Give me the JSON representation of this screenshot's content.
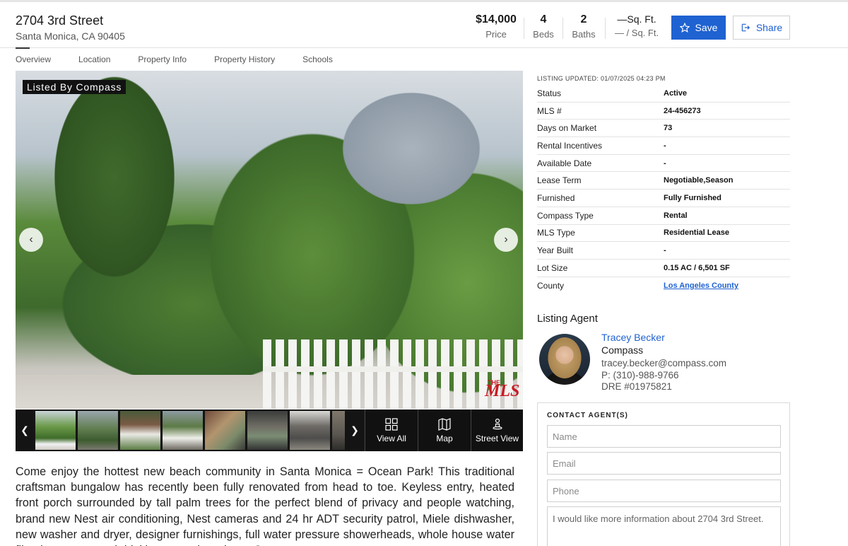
{
  "header": {
    "title": "2704 3rd Street",
    "subtitle": "Santa Monica, CA 90405",
    "stats": [
      {
        "value": "$14,000",
        "label": "Price"
      },
      {
        "value": "4",
        "label": "Beds"
      },
      {
        "value": "2",
        "label": "Baths"
      },
      {
        "value": "—Sq. Ft.",
        "label": "— / Sq. Ft."
      }
    ],
    "save_label": "Save",
    "share_label": "Share"
  },
  "tabs": [
    "Overview",
    "Location",
    "Property Info",
    "Property History",
    "Schools"
  ],
  "photo": {
    "badge": "Listed By Compass",
    "logo_text": "MLS",
    "logo_prefix": "THE"
  },
  "strip": {
    "view_all": "View All",
    "map": "Map",
    "street_view": "Street View"
  },
  "description": "Come enjoy the hottest new beach community in Santa Monica = Ocean Park! This traditional craftsman bungalow has recently been fully renovated from head to toe. Keyless entry, heated front porch surrounded by tall palm trees for the perfect blend of privacy and people watching, brand new Nest air conditioning, Nest cameras and 24 hr ADT security patrol, Miele dishwasher, new washer and dryer, designer furnishings, full water pressure showerheads, whole house water filtration system and drinking water, brand new Sonos",
  "listing": {
    "updated": "LISTING UPDATED: 01/07/2025 04:23 PM",
    "rows": [
      {
        "key": "Status",
        "value": "Active"
      },
      {
        "key": "MLS #",
        "value": "24-456273"
      },
      {
        "key": "Days on Market",
        "value": "73"
      },
      {
        "key": "Rental Incentives",
        "value": "-"
      },
      {
        "key": "Available Date",
        "value": "-"
      },
      {
        "key": "Lease Term",
        "value": "Negotiable,Season"
      },
      {
        "key": "Furnished",
        "value": "Fully Furnished"
      },
      {
        "key": "Compass Type",
        "value": "Rental"
      },
      {
        "key": "MLS Type",
        "value": "Residential Lease"
      },
      {
        "key": "Year Built",
        "value": "-"
      },
      {
        "key": "Lot Size",
        "value": "0.15 AC / 6,501 SF"
      },
      {
        "key": "County",
        "value": "Los Angeles County"
      }
    ]
  },
  "agent": {
    "heading": "Listing Agent",
    "name": "Tracey Becker",
    "company": "Compass",
    "email": "tracey.becker@compass.com",
    "phone": "P: (310)-988-9766",
    "dre": "DRE #01975821"
  },
  "contact": {
    "heading": "CONTACT AGENT(S)",
    "name_placeholder": "Name",
    "email_placeholder": "Email",
    "phone_placeholder": "Phone",
    "message_value": "I would like more information about 2704 3rd Street."
  },
  "colors": {
    "accent": "#1f62d1",
    "mls_red": "#c81b24"
  }
}
